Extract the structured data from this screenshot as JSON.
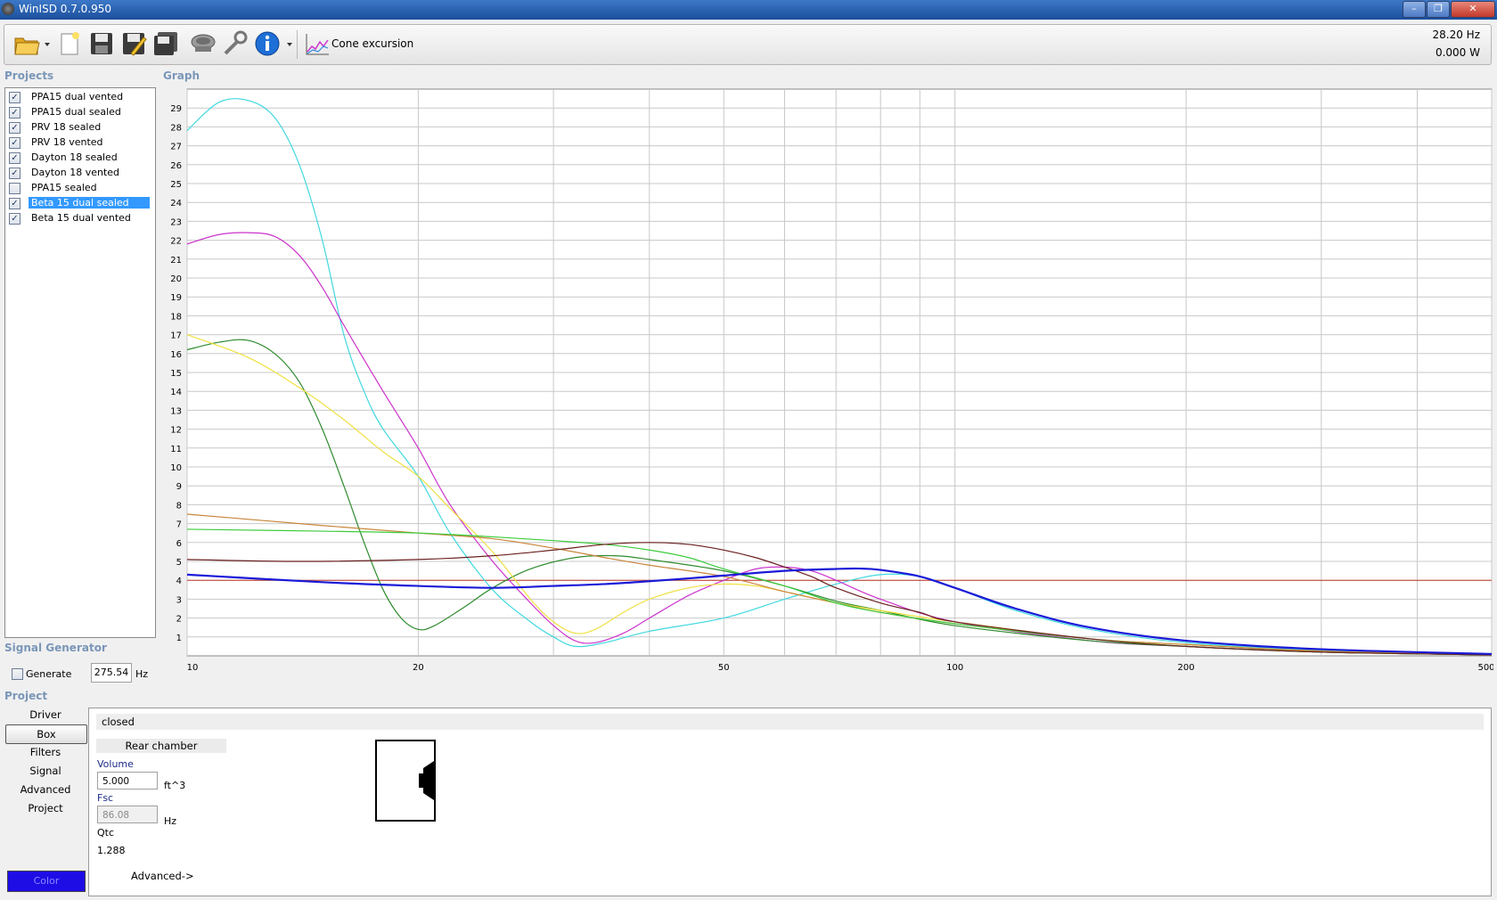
{
  "window": {
    "title": "WinISD 0.7.0.950",
    "controls": [
      "–",
      "❐",
      "✕"
    ]
  },
  "toolbar": {
    "buttons": [
      {
        "name": "open-folder-icon"
      },
      {
        "name": "new-project-icon"
      },
      {
        "name": "save-icon"
      },
      {
        "name": "save-as-icon"
      },
      {
        "name": "save-all-icon"
      },
      {
        "name": "driver-editor-icon"
      },
      {
        "name": "tools-icon"
      },
      {
        "name": "info-icon"
      }
    ],
    "graph_type_label": "Cone excursion",
    "readout_frequency": "28.20 Hz",
    "readout_power": "0.000 W"
  },
  "projects": {
    "header": "Projects",
    "items": [
      {
        "label": "PPA15 dual vented",
        "checked": true,
        "selected": false
      },
      {
        "label": "PPA15 dual sealed",
        "checked": true,
        "selected": false
      },
      {
        "label": "PRV 18 sealed",
        "checked": true,
        "selected": false
      },
      {
        "label": "PRV 18 vented",
        "checked": true,
        "selected": false
      },
      {
        "label": "Dayton 18 sealed",
        "checked": true,
        "selected": false
      },
      {
        "label": "Dayton 18 vented",
        "checked": true,
        "selected": false
      },
      {
        "label": "PPA15 sealed",
        "checked": false,
        "selected": false
      },
      {
        "label": "Beta 15 dual sealed",
        "checked": true,
        "selected": true
      },
      {
        "label": "Beta 15 dual vented",
        "checked": true,
        "selected": false
      }
    ]
  },
  "graph": {
    "header": "Graph"
  },
  "chart_data": {
    "type": "line",
    "xscale": "log",
    "xlim": [
      10,
      500
    ],
    "ylim": [
      0,
      30
    ],
    "x_tick_labels": [
      10,
      20,
      50,
      100,
      200,
      500
    ],
    "y_tick_labels": [
      1,
      2,
      3,
      4,
      5,
      6,
      7,
      8,
      9,
      10,
      11,
      12,
      13,
      14,
      15,
      16,
      17,
      18,
      19,
      20,
      21,
      22,
      23,
      24,
      25,
      26,
      27,
      28,
      29
    ],
    "grid": true,
    "limit_line": {
      "y": 4.0,
      "color": "#c0392b"
    },
    "series": [
      {
        "color": "#40d8e0",
        "width": 1.2,
        "points": [
          [
            10,
            27.8
          ],
          [
            11,
            29.3
          ],
          [
            12,
            29.4
          ],
          [
            13,
            28.5
          ],
          [
            14,
            26
          ],
          [
            15,
            22
          ],
          [
            16,
            17
          ],
          [
            17,
            14
          ],
          [
            18,
            12
          ],
          [
            20,
            9.5
          ],
          [
            22,
            6.5
          ],
          [
            25,
            3.5
          ],
          [
            28,
            1.8
          ],
          [
            30,
            1.0
          ],
          [
            32,
            0.5
          ],
          [
            35,
            0.7
          ],
          [
            40,
            1.3
          ],
          [
            50,
            2.0
          ],
          [
            60,
            3.0
          ],
          [
            70,
            3.8
          ],
          [
            80,
            4.3
          ],
          [
            90,
            4.2
          ],
          [
            100,
            3.6
          ],
          [
            120,
            2.4
          ],
          [
            150,
            1.4
          ],
          [
            200,
            0.7
          ],
          [
            300,
            0.3
          ],
          [
            500,
            0.1
          ]
        ]
      },
      {
        "color": "#cc33cc",
        "width": 1.2,
        "points": [
          [
            10,
            21.8
          ],
          [
            11,
            22.3
          ],
          [
            12,
            22.4
          ],
          [
            13,
            22.2
          ],
          [
            14,
            21.2
          ],
          [
            15,
            19.5
          ],
          [
            16,
            17.5
          ],
          [
            18,
            14
          ],
          [
            20,
            11
          ],
          [
            22,
            8
          ],
          [
            25,
            5.0
          ],
          [
            28,
            2.8
          ],
          [
            30,
            1.6
          ],
          [
            32,
            0.8
          ],
          [
            34,
            0.7
          ],
          [
            37,
            1.2
          ],
          [
            40,
            2.0
          ],
          [
            45,
            3.2
          ],
          [
            50,
            4.0
          ],
          [
            55,
            4.6
          ],
          [
            60,
            4.7
          ],
          [
            65,
            4.5
          ],
          [
            70,
            4.0
          ],
          [
            80,
            3.0
          ],
          [
            100,
            1.8
          ],
          [
            150,
            0.8
          ],
          [
            200,
            0.5
          ],
          [
            300,
            0.2
          ],
          [
            500,
            0.05
          ]
        ]
      },
      {
        "color": "#2e8b2e",
        "width": 1.2,
        "points": [
          [
            10,
            16.2
          ],
          [
            11,
            16.6
          ],
          [
            12,
            16.7
          ],
          [
            13,
            16
          ],
          [
            14,
            14.5
          ],
          [
            15,
            12
          ],
          [
            16,
            9
          ],
          [
            17,
            6
          ],
          [
            18,
            3.5
          ],
          [
            19,
            2.0
          ],
          [
            20,
            1.4
          ],
          [
            21,
            1.6
          ],
          [
            23,
            2.6
          ],
          [
            25,
            3.6
          ],
          [
            28,
            4.6
          ],
          [
            32,
            5.2
          ],
          [
            36,
            5.3
          ],
          [
            40,
            5.1
          ],
          [
            50,
            4.5
          ],
          [
            60,
            3.7
          ],
          [
            70,
            2.9
          ],
          [
            80,
            2.4
          ],
          [
            100,
            1.6
          ],
          [
            150,
            0.8
          ],
          [
            200,
            0.5
          ],
          [
            300,
            0.2
          ],
          [
            500,
            0.05
          ]
        ]
      },
      {
        "color": "#f0e040",
        "width": 1.2,
        "points": [
          [
            10,
            17.0
          ],
          [
            12,
            15.8
          ],
          [
            14,
            14.2
          ],
          [
            16,
            12.5
          ],
          [
            18,
            10.8
          ],
          [
            20,
            9.5
          ],
          [
            22,
            7.8
          ],
          [
            25,
            5.5
          ],
          [
            28,
            3.0
          ],
          [
            30,
            1.8
          ],
          [
            32,
            1.2
          ],
          [
            34,
            1.4
          ],
          [
            37,
            2.3
          ],
          [
            40,
            3.0
          ],
          [
            45,
            3.6
          ],
          [
            50,
            3.8
          ],
          [
            55,
            3.7
          ],
          [
            60,
            3.4
          ],
          [
            70,
            2.8
          ],
          [
            80,
            2.4
          ],
          [
            100,
            1.8
          ],
          [
            150,
            0.9
          ],
          [
            200,
            0.6
          ],
          [
            300,
            0.25
          ],
          [
            500,
            0.05
          ]
        ]
      },
      {
        "color": "#c8843a",
        "width": 1.2,
        "points": [
          [
            10,
            7.5
          ],
          [
            15,
            6.9
          ],
          [
            20,
            6.5
          ],
          [
            25,
            6.2
          ],
          [
            30,
            5.7
          ],
          [
            35,
            5.2
          ],
          [
            40,
            4.8
          ],
          [
            50,
            4.2
          ],
          [
            60,
            3.4
          ],
          [
            70,
            2.8
          ],
          [
            80,
            2.3
          ],
          [
            100,
            1.7
          ],
          [
            150,
            0.9
          ],
          [
            200,
            0.6
          ],
          [
            300,
            0.25
          ],
          [
            500,
            0.05
          ]
        ]
      },
      {
        "color": "#3ccc3c",
        "width": 1.2,
        "points": [
          [
            10,
            6.7
          ],
          [
            15,
            6.6
          ],
          [
            20,
            6.5
          ],
          [
            25,
            6.3
          ],
          [
            30,
            6.1
          ],
          [
            35,
            5.9
          ],
          [
            40,
            5.6
          ],
          [
            45,
            5.2
          ],
          [
            50,
            4.6
          ],
          [
            60,
            3.7
          ],
          [
            70,
            2.8
          ],
          [
            80,
            2.3
          ],
          [
            100,
            1.7
          ],
          [
            150,
            0.9
          ],
          [
            200,
            0.5
          ],
          [
            300,
            0.2
          ],
          [
            500,
            0.05
          ]
        ]
      },
      {
        "color": "#6b1f1f",
        "width": 1.2,
        "points": [
          [
            10,
            5.1
          ],
          [
            14,
            5.0
          ],
          [
            20,
            5.1
          ],
          [
            25,
            5.3
          ],
          [
            30,
            5.6
          ],
          [
            35,
            5.9
          ],
          [
            40,
            6.0
          ],
          [
            45,
            5.9
          ],
          [
            50,
            5.6
          ],
          [
            55,
            5.2
          ],
          [
            60,
            4.7
          ],
          [
            65,
            4.2
          ],
          [
            70,
            3.6
          ],
          [
            80,
            2.8
          ],
          [
            90,
            2.3
          ],
          [
            100,
            1.8
          ],
          [
            150,
            0.9
          ],
          [
            200,
            0.5
          ],
          [
            300,
            0.2
          ],
          [
            500,
            0.05
          ]
        ]
      },
      {
        "color": "#1a1ad8",
        "width": 2.2,
        "points": [
          [
            10,
            4.3
          ],
          [
            15,
            3.9
          ],
          [
            20,
            3.7
          ],
          [
            25,
            3.6
          ],
          [
            30,
            3.7
          ],
          [
            35,
            3.8
          ],
          [
            40,
            3.95
          ],
          [
            45,
            4.1
          ],
          [
            50,
            4.25
          ],
          [
            60,
            4.5
          ],
          [
            70,
            4.6
          ],
          [
            75,
            4.62
          ],
          [
            80,
            4.55
          ],
          [
            90,
            4.2
          ],
          [
            100,
            3.6
          ],
          [
            120,
            2.5
          ],
          [
            150,
            1.5
          ],
          [
            200,
            0.8
          ],
          [
            300,
            0.35
          ],
          [
            500,
            0.1
          ]
        ]
      }
    ]
  },
  "signal_generator": {
    "header": "Signal Generator",
    "generate_label": "Generate",
    "generate_checked": false,
    "frequency": "275.54",
    "frequency_unit": "Hz"
  },
  "project_section": {
    "header": "Project",
    "nav": [
      "Driver",
      "Box",
      "Filters",
      "Signal",
      "Advanced",
      "Project"
    ],
    "active_nav": "Box",
    "color_button": "Color",
    "color_value": "#1f0de6"
  },
  "box": {
    "type": "closed",
    "chamber_label": "Rear chamber",
    "volume_label": "Volume",
    "volume_value": "5.000",
    "volume_unit": "ft^3",
    "fsc_label": "Fsc",
    "fsc_value": "86.08",
    "fsc_unit": "Hz",
    "qtc_label": "Qtc",
    "qtc_value": "1.288",
    "advanced_label": "Advanced->"
  }
}
